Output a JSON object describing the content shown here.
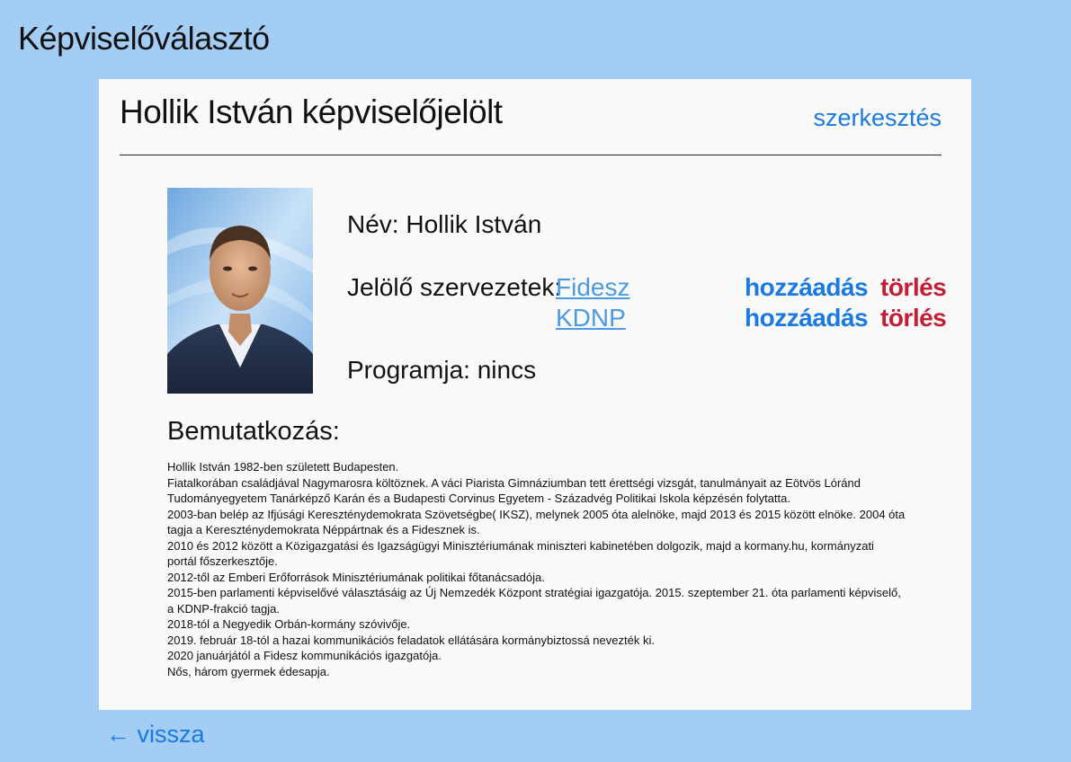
{
  "app": {
    "title": "Képviselőválasztó"
  },
  "candidate": {
    "heading": "Hollik István képviselőjelölt",
    "edit_label": "szerkesztés",
    "name_label": "Név:",
    "name_value": "Hollik István",
    "orgs_label": "Jelölő szervezetek:",
    "organizations": [
      {
        "name": "Fidesz",
        "add_label": "hozzáadás",
        "delete_label": "törlés"
      },
      {
        "name": "KDNP",
        "add_label": "hozzáadás",
        "delete_label": "törlés"
      }
    ],
    "program_label": "Programja:",
    "program_value": "nincs",
    "photo_icon": "candidate-portrait"
  },
  "intro": {
    "heading": "Bemutatkozás:",
    "lines": [
      "Hollik István 1982-ben született Budapesten.",
      "Fiatalkorában családjával Nagymarosra költöznek. A váci Piarista Gimnáziumban tett érettségi vizsgát, tanulmányait az Eötvös Lóránd",
      "Tudományegyetem Tanárképző Karán és a Budapesti Corvinus Egyetem - Századvég Politikai Iskola képzésén folytatta.",
      "2003-ban belép az Ifjúsági Kereszténydemokrata Szövetségbe( IKSZ), melynek 2005 óta alelnöke, majd 2013 és 2015 között elnöke. 2004 óta",
      "tagja a Kereszténydemokrata Néppártnak és a Fidesznek is.",
      "2010 és 2012 között a Közigazgatási és Igazságügyi Minisztériumának miniszteri kabinetében dolgozik, majd a kormany.hu, kormányzati",
      "portál főszerkesztője.",
      "2012-től az Emberi Erőforrások Minisztériumának politikai főtanácsadója.",
      "2015-ben parlamenti képviselővé választásáig az Új Nemzedék Központ stratégiai igazgatója. 2015. szeptember 21. óta parlamenti képviselő,",
      "a KDNP-frakció tagja.",
      "2018-tól a Negyedik Orbán-kormány szóvivője.",
      "2019. február 18-tól a hazai kommunikációs feladatok ellátására kormánybiztossá nevezték ki.",
      "2020 januárjától a Fidesz kommunikációs igazgatója.",
      "Nős, három gyermek édesapja."
    ]
  },
  "nav": {
    "back_label": "← vissza"
  },
  "colors": {
    "background": "#a3cdf4",
    "card": "#fafafa",
    "link": "#1a7ae0",
    "org_link": "#4a9ae6",
    "delete": "#c41e35"
  }
}
